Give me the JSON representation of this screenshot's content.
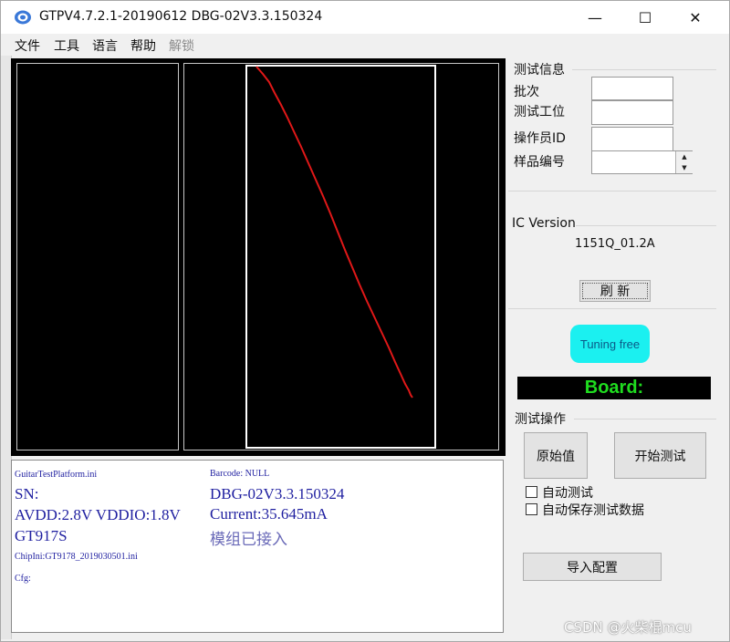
{
  "window": {
    "title": "GTPV4.7.2.1-20190612  DBG-02V3.3.150324",
    "minimize_glyph": "—",
    "maximize_glyph": "☐",
    "close_glyph": "✕"
  },
  "menu": {
    "items": [
      "文件",
      "工具",
      "语言",
      "帮助"
    ],
    "disabled_item": "解锁"
  },
  "info_panel": {
    "ini_file": "GuitarTestPlatform.ini",
    "barcode": "Barcode: NULL",
    "sn": "SN:",
    "dbg_version": "DBG-02V3.3.150324",
    "voltage": "AVDD:2.8V VDDIO:1.8V",
    "current": "Current:35.645mA",
    "chip": "GT917S",
    "module_status": "模组已接入",
    "chip_ini": "ChipIni:GT9178_2019030501.ini",
    "cfg": "Cfg:"
  },
  "test_info": {
    "group_title": "测试信息",
    "batch_label": "批次",
    "station_label": "测试工位",
    "operator_label": "操作员ID",
    "sample_label": "样品编号",
    "batch_value": "",
    "station_value": "",
    "operator_value": "",
    "sample_value": ""
  },
  "ic_version": {
    "title": "IC Version",
    "value": "1151Q_01.2A",
    "refresh_label": "刷 新"
  },
  "status": {
    "tuning_label": "Tuning free",
    "board_label": "Board:"
  },
  "test_ops": {
    "group_title": "测试操作",
    "raw_button": "原始值",
    "start_button": "开始测试",
    "auto_test_label": "自动测试",
    "auto_save_label": "自动保存测试数据",
    "import_button": "导入配置"
  },
  "watermark": "CSDN @火柴棍mcu",
  "colors": {
    "trace": "#e01818",
    "board_text": "#1fdc1f",
    "tuning_bg": "#1bf0f0",
    "info_text": "#1f1fa0"
  }
}
